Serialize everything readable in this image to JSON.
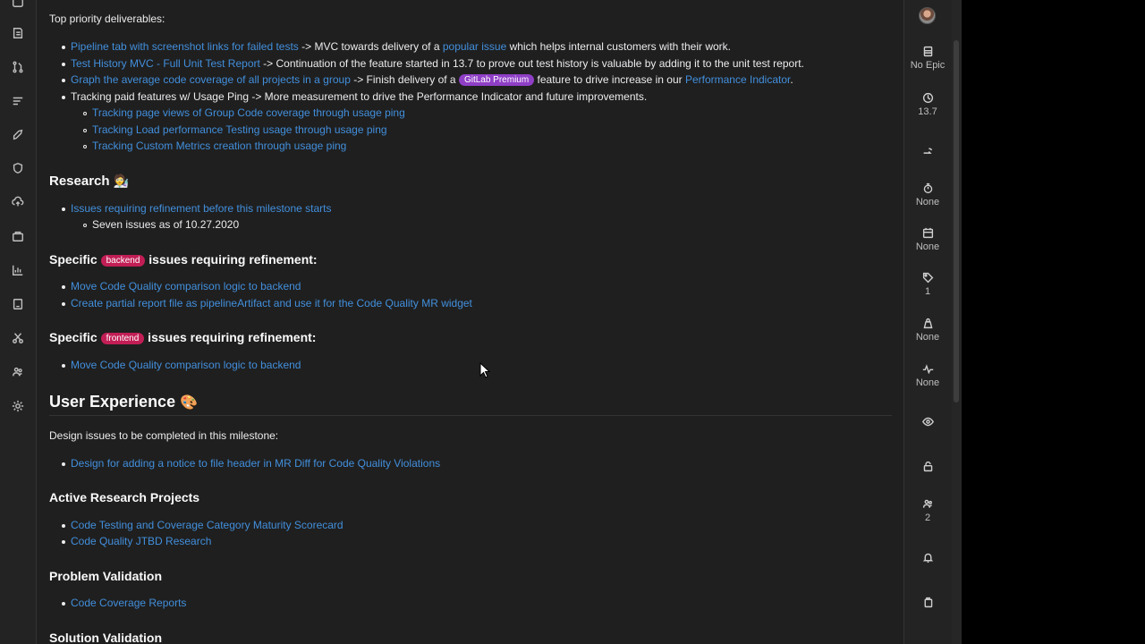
{
  "content": {
    "intro": "Top priority deliverables:",
    "deliverables": [
      {
        "link": "Pipeline tab with screenshot links for failed tests",
        "t1": " -> MVC towards delivery of a ",
        "link2": "popular issue",
        "t2": " which helps internal customers with their work."
      },
      {
        "link": "Test History MVC - Full Unit Test Report",
        "t1": " -> Continuation of the feature started in 13.7 to prove out test history is valuable by adding it to the unit test report."
      },
      {
        "link": "Graph the average code coverage of all projects in a group",
        "t1": " -> Finish delivery of a ",
        "label": "GitLab Premium",
        "t2": " feature to drive increase in our ",
        "link2": "Performance Indicator",
        "t3": "."
      },
      {
        "text": "Tracking paid features w/ Usage Ping -> More measurement to drive the Performance Indicator and future improvements."
      }
    ],
    "tracking_items": [
      "Tracking page views of Group Code coverage through usage ping",
      "Tracking Load performance Testing usage through usage ping",
      "Tracking Custom Metrics creation through usage ping"
    ],
    "research_heading": "Research",
    "research_link": "Issues requiring refinement before this milestone starts",
    "research_sub": "Seven issues as of 10.27.2020",
    "backend_heading": {
      "pre": "Specific ",
      "label": "backend",
      "post": " issues requiring refinement:"
    },
    "backend_items": [
      "Move Code Quality comparison logic to backend",
      "Create partial report file as pipelineArtifact and use it for the Code Quality MR widget"
    ],
    "frontend_heading": {
      "pre": "Specific ",
      "label": "frontend",
      "post": " issues requiring refinement:"
    },
    "frontend_items": [
      "Move Code Quality comparison logic to backend"
    ],
    "ux_heading": "User Experience",
    "design_intro": "Design issues to be completed in this milestone:",
    "design_items": [
      "Design for adding a notice to file header in MR Diff for Code Quality Violations"
    ],
    "active_research_heading": "Active Research Projects",
    "active_research_items": [
      "Code Testing and Coverage Category Maturity Scorecard",
      "Code Quality JTBD Research"
    ],
    "problem_validation_heading": "Problem Validation",
    "problem_validation_items": [
      "Code Coverage Reports"
    ],
    "solution_validation_heading": "Solution Validation"
  },
  "sidebar": {
    "epic": "No Epic",
    "milestone": "13.7",
    "time_tracking": "None",
    "due_date": "None",
    "labels_count": "1",
    "weight": "None",
    "health": "None",
    "participants": "2"
  },
  "colors": {
    "link": "#428fdc",
    "label_premium": "#8f3fc6",
    "label_backend": "#c21e56",
    "label_frontend": "#c21e56"
  }
}
